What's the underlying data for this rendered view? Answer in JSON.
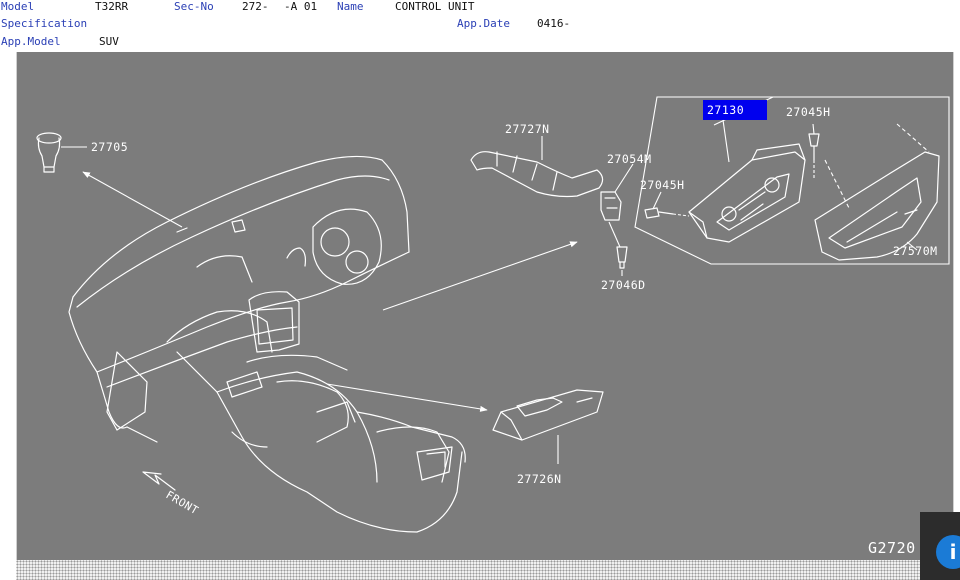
{
  "header": {
    "model_label": "Model",
    "model_value": "T32RR",
    "secno_label": "Sec-No",
    "secno_value": "272-",
    "secno_suffix": "-A 01",
    "name_label": "Name",
    "name_value": "CONTROL UNIT",
    "spec_label": "Specification",
    "spec_value": "",
    "appdate_label": "App.Date",
    "appdate_value": "0416-",
    "appmodel_label": "App.Model",
    "appmodel_value": "SUV"
  },
  "diagram": {
    "background_color": "#7c7c7c",
    "highlight_color": "#0000ee",
    "figure_code": "G2720",
    "front_label": "FRONT",
    "parts": {
      "p27130": "27130",
      "p27045H_top": "27045H",
      "p27045H_mid": "27045H",
      "p27705": "27705",
      "p27727N": "27727N",
      "p27054M": "27054M",
      "p27046D": "27046D",
      "p27570M": "27570M",
      "p27726N": "27726N"
    },
    "selected_part": "27130"
  },
  "info_button": {
    "label": "i",
    "color": "#1b7bd6"
  }
}
